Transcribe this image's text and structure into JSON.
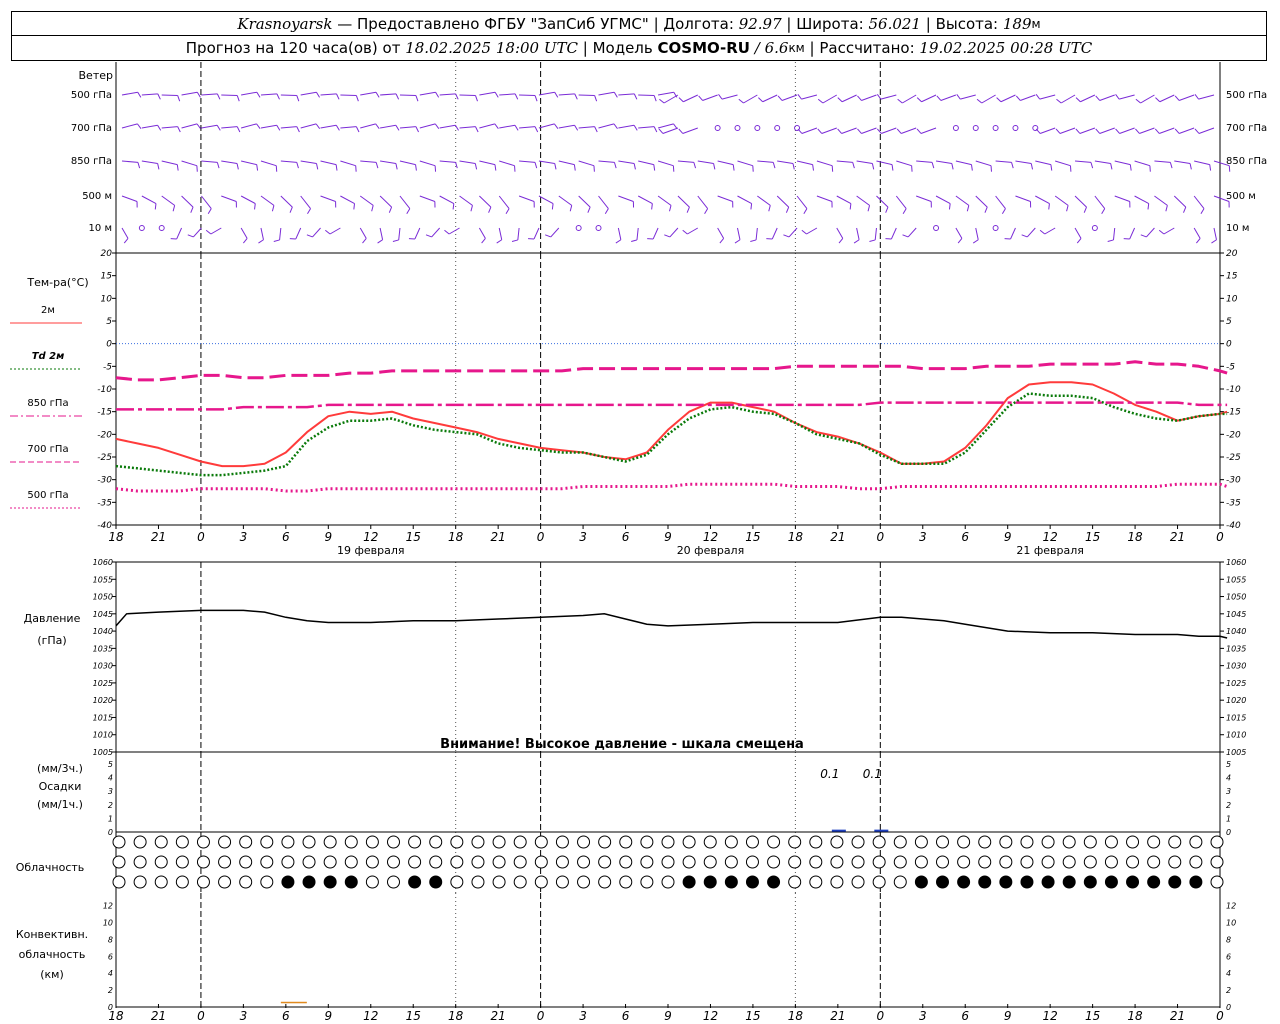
{
  "header": {
    "station": "Krasnoyarsk",
    "provider": " — Предоставлено ФГБУ \"ЗапСиб УГМС\" | Долгота: ",
    "lon": "92.97",
    "lat_label": " | Широта: ",
    "lat": "56.021",
    "alt_label": " | Высота: ",
    "alt": "189",
    "alt_unit": "м",
    "fc_prefix": "Прогноз на 120 часа(ов) от ",
    "fc_start": "18.02.2025 18:00 UTC",
    "model_label": " | Модель ",
    "model": "COSMO-RU",
    "res": " / 6.6",
    "res_unit": "км",
    "calc_label": " | Рассчитано: ",
    "calc": "19.02.2025 00:28 UTC"
  },
  "labels": {
    "wind_title": "Ветер",
    "wind_levels": [
      "500 гПа",
      "700 гПа",
      "850 гПа",
      "500 м",
      "10  м"
    ],
    "temp_title": "Тем-ра(°С)",
    "legend": [
      {
        "text": "2м",
        "color": "#ff3b3b",
        "style": "solid"
      },
      {
        "text": "Td  2м",
        "color": "#0a7a0a",
        "style": "dot"
      },
      {
        "text": "850 гПа",
        "color": "#e6178c",
        "style": "dashdot"
      },
      {
        "text": "700 гПа",
        "color": "#e6178c",
        "style": "dash"
      },
      {
        "text": "500 гПа",
        "color": "#e6178c",
        "style": "dot"
      }
    ],
    "pressure_title": "Давление",
    "pressure_unit": "(гПа)",
    "pressure_note": "Внимание! Высокое давление - шкала смещена",
    "precip_unit1": "(мм/3ч.)",
    "precip_title": "Осадки",
    "precip_unit2": "(мм/1ч.)",
    "cloud_title": "Облачность",
    "conv_title1": "Конвективн.",
    "conv_title2": "облачность",
    "conv_unit": "(км)",
    "days": [
      "19 февраля",
      "20 февраля",
      "21 февраля"
    ],
    "hour_ticks": [
      "18",
      "21",
      "0",
      "3",
      "6",
      "9",
      "12",
      "15",
      "18",
      "21",
      "0",
      "3",
      "6",
      "9",
      "12",
      "15",
      "18",
      "21",
      "0",
      "3",
      "6",
      "9",
      "12",
      "15",
      "18",
      "21",
      "0"
    ]
  },
  "chart_data": [
    {
      "type": "line",
      "title": "Тем-ра(°С)",
      "x_hours": [
        0,
        6,
        12,
        18,
        24,
        30,
        36,
        42,
        48,
        54,
        60,
        66,
        72,
        78,
        84,
        90,
        96,
        102,
        108,
        114,
        120,
        126,
        132,
        138,
        144,
        150,
        156,
        162,
        168,
        174,
        180,
        186,
        192,
        198,
        204,
        210,
        216,
        222,
        228,
        234,
        240,
        246,
        252,
        258,
        264,
        270,
        276,
        282,
        288,
        294,
        300,
        306,
        312,
        314
      ],
      "ylim": [
        -40,
        20
      ],
      "yticks": [
        20,
        15,
        10,
        5,
        0,
        -5,
        -10,
        -15,
        -20,
        -25,
        -30,
        -35,
        -40
      ],
      "series": [
        {
          "name": "2м",
          "color": "#ff3b3b",
          "values": [
            -21,
            -22,
            -23,
            -24.5,
            -26,
            -27,
            -27,
            -26.5,
            -24,
            -19.5,
            -16,
            -15,
            -15.5,
            -15,
            -16.5,
            -17.5,
            -18.5,
            -19.5,
            -21,
            -22,
            -23,
            -23.5,
            -24,
            -25,
            -25.5,
            -24,
            -19,
            -15,
            -13,
            -13,
            -14,
            -15,
            -17.5,
            -19.5,
            -20.5,
            -22,
            -24,
            -26.5,
            -26.5,
            -26,
            -23,
            -18,
            -12,
            -9,
            -8.5,
            -8.5,
            -9,
            -11,
            -13.5,
            -15,
            -17,
            -16,
            -15.5,
            -15
          ]
        },
        {
          "name": "Td  2м",
          "color": "#0a7a0a",
          "values": [
            -27,
            -27.5,
            -28,
            -28.5,
            -29,
            -29,
            -28.5,
            -28,
            -27,
            -21.5,
            -18.5,
            -17,
            -17,
            -16.5,
            -18,
            -19,
            -19.5,
            -20,
            -22,
            -23,
            -23.5,
            -24,
            -24,
            -25,
            -26,
            -24.5,
            -20,
            -16.5,
            -14.5,
            -14,
            -15,
            -15.5,
            -17.5,
            -20,
            -21,
            -22,
            -24.5,
            -26.5,
            -26.5,
            -26.5,
            -24,
            -19,
            -14,
            -11,
            -11.5,
            -11.5,
            -12,
            -14,
            -15.5,
            -16.5,
            -17,
            -16,
            -15.5,
            -15.5
          ]
        },
        {
          "name": "850 гПа",
          "color": "#e6178c",
          "values": [
            -14.5,
            -14.5,
            -14.5,
            -14.5,
            -14.5,
            -14.5,
            -14,
            -14,
            -14,
            -14,
            -13.5,
            -13.5,
            -13.5,
            -13.5,
            -13.5,
            -13.5,
            -13.5,
            -13.5,
            -13.5,
            -13.5,
            -13.5,
            -13.5,
            -13.5,
            -13.5,
            -13.5,
            -13.5,
            -13.5,
            -13.5,
            -13.5,
            -13.5,
            -13.5,
            -13.5,
            -13.5,
            -13.5,
            -13.5,
            -13.5,
            -13,
            -13,
            -13,
            -13,
            -13,
            -13,
            -13,
            -13,
            -13,
            -13,
            -13,
            -13,
            -13,
            -13,
            -13,
            -13.5,
            -13.5,
            -13.5
          ]
        },
        {
          "name": "700 гПа",
          "color": "#e6178c",
          "values": [
            -7.5,
            -8,
            -8,
            -7.5,
            -7,
            -7,
            -7.5,
            -7.5,
            -7,
            -7,
            -7,
            -6.5,
            -6.5,
            -6,
            -6,
            -6,
            -6,
            -6,
            -6,
            -6,
            -6,
            -6,
            -5.5,
            -5.5,
            -5.5,
            -5.5,
            -5.5,
            -5.5,
            -5.5,
            -5.5,
            -5.5,
            -5.5,
            -5,
            -5,
            -5,
            -5,
            -5,
            -5,
            -5.5,
            -5.5,
            -5.5,
            -5,
            -5,
            -5,
            -4.5,
            -4.5,
            -4.5,
            -4.5,
            -4,
            -4.5,
            -4.5,
            -5,
            -6,
            -6.5
          ]
        },
        {
          "name": "500 гПа",
          "color": "#e6178c",
          "values": [
            -32,
            -32.5,
            -32.5,
            -32.5,
            -32,
            -32,
            -32,
            -32,
            -32.5,
            -32.5,
            -32,
            -32,
            -32,
            -32,
            -32,
            -32,
            -32,
            -32,
            -32,
            -32,
            -32,
            -32,
            -31.5,
            -31.5,
            -31.5,
            -31.5,
            -31.5,
            -31,
            -31,
            -31,
            -31,
            -31,
            -31.5,
            -31.5,
            -31.5,
            -32,
            -32,
            -31.5,
            -31.5,
            -31.5,
            -31.5,
            -31.5,
            -31.5,
            -31.5,
            -31.5,
            -31.5,
            -31.5,
            -31.5,
            -31.5,
            -31.5,
            -31,
            -31,
            -31,
            -31.5
          ]
        }
      ]
    },
    {
      "type": "line",
      "title": "Давление",
      "x_hours": [
        0,
        3,
        12,
        24,
        36,
        42,
        48,
        54,
        60,
        72,
        84,
        96,
        108,
        120,
        132,
        138,
        144,
        150,
        156,
        168,
        180,
        192,
        204,
        216,
        222,
        228,
        234,
        240,
        252,
        264,
        276,
        288,
        300,
        306,
        312,
        314
      ],
      "ylim": [
        1005,
        1060
      ],
      "yticks": [
        1060,
        1055,
        1050,
        1045,
        1040,
        1035,
        1030,
        1025,
        1020,
        1015,
        1010,
        1005
      ],
      "series": [
        {
          "name": "Давление",
          "color": "#000000",
          "values": [
            1041.5,
            1045,
            1045.5,
            1046,
            1046,
            1045.5,
            1044,
            1043,
            1042.5,
            1042.5,
            1043,
            1043,
            1043.5,
            1044,
            1044.5,
            1045,
            1043.5,
            1042,
            1041.5,
            1042,
            1042.5,
            1042.5,
            1042.5,
            1044,
            1044,
            1043.5,
            1043,
            1042,
            1040,
            1039.5,
            1039.5,
            1039,
            1039,
            1038.5,
            1038.5,
            1038
          ]
        }
      ]
    },
    {
      "type": "bar",
      "title": "Осадки",
      "ylim": [
        0,
        5
      ],
      "yticks": [
        5,
        4,
        3,
        2,
        1,
        0
      ],
      "series": [
        {
          "name": "Осадки",
          "color": "#1e3fbf",
          "x_hours": [
            204,
            216
          ],
          "values": [
            0.1,
            0.1
          ]
        }
      ],
      "annotations": [
        "0.1",
        "0.1"
      ]
    },
    {
      "type": "bar",
      "title": "Конвективн. облачность",
      "ylim": [
        0,
        13
      ],
      "yticks": [
        12,
        10,
        8,
        6,
        4,
        2,
        0
      ],
      "series": [
        {
          "name": "Конвективн. облачность",
          "color": "#e08a1e",
          "x_hours": [
            48
          ],
          "values": [
            0.5
          ]
        }
      ]
    }
  ]
}
